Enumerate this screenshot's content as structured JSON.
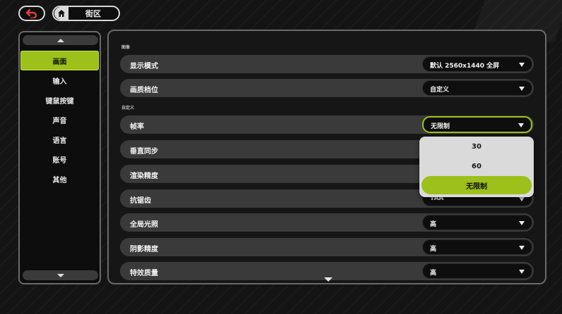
{
  "breadcrumb": {
    "current": "街区"
  },
  "sidebar": {
    "items": [
      {
        "label": "画面",
        "active": true
      },
      {
        "label": "输入",
        "active": false
      },
      {
        "label": "键鼠按键",
        "active": false
      },
      {
        "label": "声音",
        "active": false
      },
      {
        "label": "语言",
        "active": false
      },
      {
        "label": "账号",
        "active": false
      },
      {
        "label": "其他",
        "active": false
      }
    ]
  },
  "settings": {
    "section_image": "图像",
    "section_custom": "自定义",
    "rows": [
      {
        "label": "显示模式",
        "value": "默认 2560x1440 全屏"
      },
      {
        "label": "画质档位",
        "value": "自定义"
      },
      {
        "label": "帧率",
        "value": "无限制"
      },
      {
        "label": "垂直同步",
        "value": ""
      },
      {
        "label": "渲染精度",
        "value": ""
      },
      {
        "label": "抗锯齿",
        "value": "TAA"
      },
      {
        "label": "全局光照",
        "value": "高"
      },
      {
        "label": "阴影精度",
        "value": "高"
      },
      {
        "label": "特效质量",
        "value": "高"
      }
    ],
    "framerate_options": [
      {
        "label": "30",
        "selected": false
      },
      {
        "label": "60",
        "selected": false
      },
      {
        "label": "无限制",
        "selected": true
      }
    ]
  },
  "theme": {
    "accent": "#9bc11a",
    "row_bg": "#3a3a3a"
  },
  "icons": {
    "back": "return-arrow-icon",
    "home": "home-icon"
  }
}
